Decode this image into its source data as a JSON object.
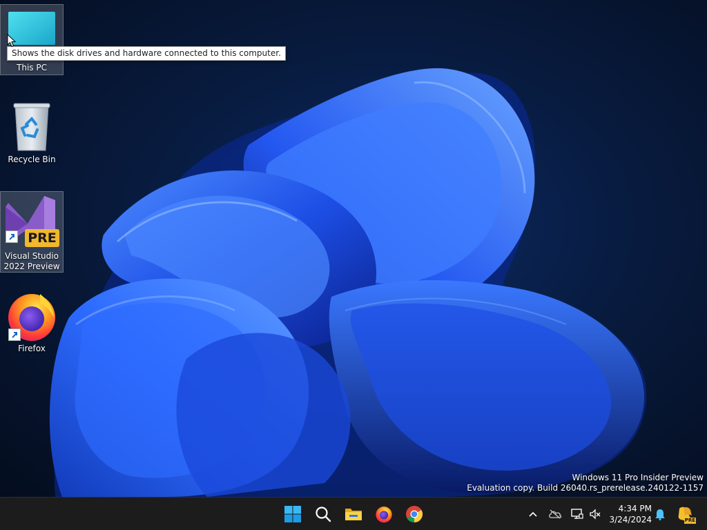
{
  "desktop": {
    "icons": [
      {
        "label": "This PC",
        "icon": "monitor-icon"
      },
      {
        "label": "Recycle Bin",
        "icon": "recycle-bin-icon"
      },
      {
        "label": "Visual Studio 2022 Preview",
        "icon": "visual-studio-preview-icon",
        "badge": "PRE",
        "shortcut": true
      },
      {
        "label": "Firefox",
        "icon": "firefox-icon",
        "shortcut": true
      }
    ],
    "tooltip": "Shows the disk drives and hardware connected to this computer.",
    "watermark": {
      "line1": "Windows 11 Pro Insider Preview",
      "line2": "Evaluation copy. Build 26040.rs_prerelease.240122-1157"
    }
  },
  "taskbar": {
    "pinned": [
      "start-icon",
      "search-icon",
      "file-explorer-icon",
      "firefox-icon",
      "chrome-icon"
    ],
    "tray": [
      "chevron-up-icon",
      "onedrive-offline-icon",
      "network-icon",
      "volume-muted-icon",
      "notification-bell-icon",
      "copilot-pre-icon"
    ],
    "copilot_badge": "PRE",
    "clock": {
      "time": "4:34 PM",
      "date": "3/24/2024"
    }
  },
  "colors": {
    "taskbar_bg": "#1c1c1c",
    "wallpaper_accent": "#1e5cff",
    "tooltip_bg": "#ffffff"
  }
}
